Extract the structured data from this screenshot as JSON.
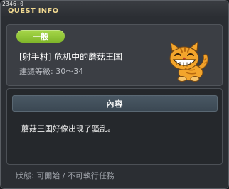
{
  "window": {
    "id_label": "2346-0",
    "title": "QUEST INFO"
  },
  "quest": {
    "category": "一般",
    "name": "[射手村] 危机中的蘑菇王国",
    "level_requirement": "建議等級: 30～34"
  },
  "content": {
    "header": "內容",
    "description": "蘑菇王国好像出现了骚乱。"
  },
  "status": {
    "text": "狀態: 可開始 / 不可執行任務"
  },
  "colors": {
    "badge": "#8fc436",
    "title": "#f0d890",
    "background": "#2b2e33"
  }
}
